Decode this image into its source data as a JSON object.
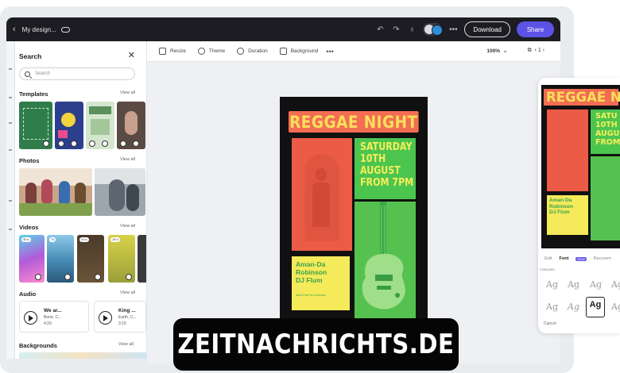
{
  "topbar": {
    "back_icon": "chevron-left-icon",
    "title": "My design...",
    "cloud_icon": "cloud-icon",
    "download_label": "Download",
    "share_label": "Share",
    "accent": "#5c53e6"
  },
  "toolbar": {
    "resize": "Resize",
    "theme": "Theme",
    "duration": "Duration",
    "background": "Background",
    "more": "•••",
    "zoom": "100%",
    "page": "1"
  },
  "panel": {
    "heading": "Search",
    "close": "✕",
    "search_placeholder": "Search",
    "view_all": "View all",
    "sections": {
      "templates": "Templates",
      "photos": "Photos",
      "videos": "Videos",
      "audio": "Audio",
      "backgrounds": "Backgrounds"
    },
    "video_badges": [
      "30.s",
      "7s",
      "10.s",
      "15.s"
    ],
    "audio": [
      {
        "title": "We ar...",
        "artist": "Bono, C...",
        "duration": "4:20"
      },
      {
        "title": "King ...",
        "artist": "Earth, C...",
        "duration": "3:15"
      }
    ]
  },
  "poster": {
    "title": "REGGAE NIGHT",
    "date_lines": [
      "SATURDAY",
      "10TH",
      "AUGUST",
      "FROM 7PM"
    ],
    "performer_lines": [
      "Aman-Da",
      "Robinson",
      "DJ Flum"
    ],
    "small_text": "Admit Free for everyone"
  },
  "right_panel": {
    "title": "REGGAE NI",
    "date_lines": [
      "SATU",
      "10TH",
      "AUGU",
      "FROM"
    ],
    "performer_lines": [
      "Aman-Da",
      "Robinson",
      "DJ Flum"
    ],
    "tabs": [
      "Edit",
      "Font",
      "NEW",
      "Recomm"
    ],
    "std_label": "STANDARD",
    "font_sample": "Ag",
    "cancel": "Cancel"
  },
  "watermark": "ZEITNACHRICHTS.DE"
}
